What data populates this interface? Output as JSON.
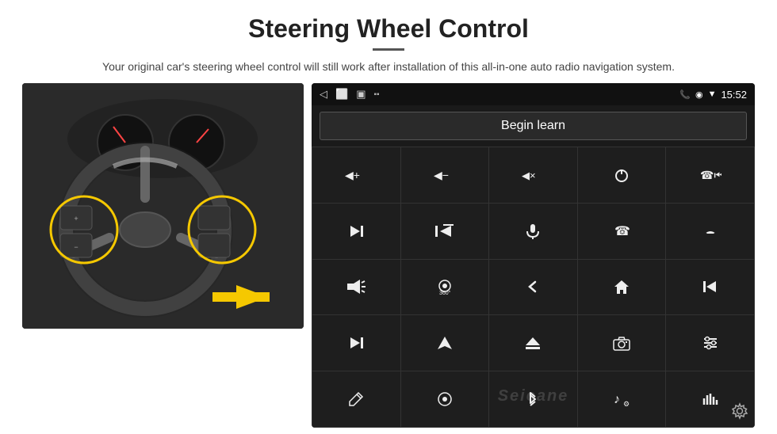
{
  "header": {
    "title": "Steering Wheel Control",
    "subtitle": "Your original car's steering wheel control will still work after installation of this all-in-one auto radio navigation system."
  },
  "android_screen": {
    "status_bar": {
      "time": "15:52"
    },
    "begin_learn_button": "Begin learn",
    "watermark": "Seicane",
    "controls": [
      {
        "icon": "vol+",
        "unicode": "🔊+",
        "symbol": "◀+"
      },
      {
        "icon": "vol-",
        "unicode": "🔉-",
        "symbol": "◀−"
      },
      {
        "icon": "mute",
        "unicode": "🔇",
        "symbol": "◀×"
      },
      {
        "icon": "power",
        "unicode": "⏻",
        "symbol": "⏻"
      },
      {
        "icon": "prev-track",
        "unicode": "⏮",
        "symbol": "⏮"
      },
      {
        "icon": "next",
        "unicode": "⏭",
        "symbol": "⏭"
      },
      {
        "icon": "fast-prev",
        "unicode": "⏪",
        "symbol": "⏪"
      },
      {
        "icon": "mic",
        "unicode": "🎤",
        "symbol": "🎤"
      },
      {
        "icon": "phone",
        "unicode": "📞",
        "symbol": "☎"
      },
      {
        "icon": "hang-up",
        "unicode": "📵",
        "symbol": "↩"
      },
      {
        "icon": "horn",
        "unicode": "📢",
        "symbol": "📢"
      },
      {
        "icon": "360",
        "unicode": "🔄",
        "symbol": "360°"
      },
      {
        "icon": "back",
        "unicode": "↩",
        "symbol": "↩"
      },
      {
        "icon": "home",
        "unicode": "⌂",
        "symbol": "⌂"
      },
      {
        "icon": "skip-prev",
        "unicode": "⏮",
        "symbol": "⏮"
      },
      {
        "icon": "next-track",
        "unicode": "⏭",
        "symbol": "⏭"
      },
      {
        "icon": "nav",
        "unicode": "➤",
        "symbol": "➤"
      },
      {
        "icon": "eject",
        "unicode": "⏏",
        "symbol": "⏏"
      },
      {
        "icon": "camera",
        "unicode": "📷",
        "symbol": "📷"
      },
      {
        "icon": "settings-eq",
        "unicode": "⚙",
        "symbol": "⚙"
      },
      {
        "icon": "pen",
        "unicode": "✏",
        "symbol": "✏"
      },
      {
        "icon": "settings2",
        "unicode": "⚙",
        "symbol": "⚙"
      },
      {
        "icon": "bluetooth",
        "unicode": "✦",
        "symbol": "⚡"
      },
      {
        "icon": "music",
        "unicode": "♪",
        "symbol": "♪"
      },
      {
        "icon": "equalizer",
        "unicode": "≡",
        "symbol": "≡"
      }
    ]
  }
}
